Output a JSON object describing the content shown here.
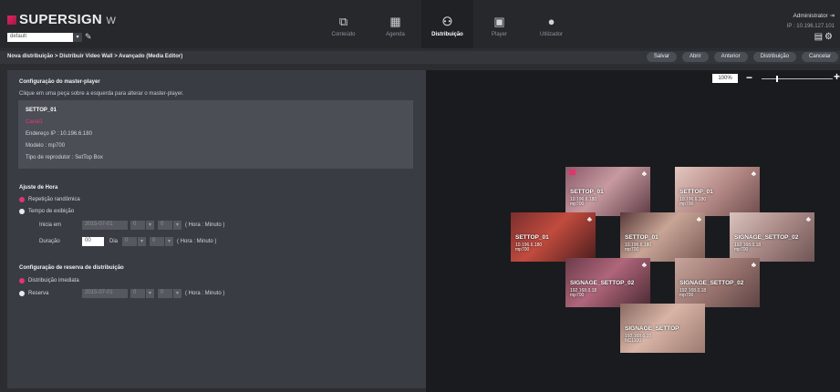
{
  "app": {
    "logo": "SUPERSIGN",
    "logo_suffix": "W",
    "site": "default"
  },
  "nav": [
    {
      "label": "Conteúdo",
      "icon": "content-icon"
    },
    {
      "label": "Agenda",
      "icon": "calendar-icon"
    },
    {
      "label": "Distribuição",
      "icon": "distribution-icon",
      "active": true
    },
    {
      "label": "Player",
      "icon": "player-icon"
    },
    {
      "label": "Utilizador",
      "icon": "user-icon"
    }
  ],
  "user": {
    "name": "Administrator",
    "ip": "IP : 10.196.127.101"
  },
  "breadcrumb": "Nova distribuição > Distribuir Video Wall > Avançado (Media Editor)",
  "actions": [
    "Salvar",
    "Abrir",
    "Anterior",
    "Distribuição",
    "Cancelar"
  ],
  "master": {
    "title": "Configuração do master-player",
    "hint": "Clique em uma peça sobre a esquerda para alterar o master-player.",
    "name": "SETTOP_01",
    "canal": "Canal1",
    "ip": "Endereço IP : 10.196.6.180",
    "model": "Modelo : mp700",
    "type": "Tipo de reprodutor : SetTop Box"
  },
  "time": {
    "title": "Ajuste de Hora",
    "random": "Repetição randômica",
    "duration_mode": "Tempo de exibição",
    "start_label": "Inicia em",
    "start_date": "2015-07-01",
    "start_h": "0",
    "start_m": "0",
    "hm": "( Hora : Minuto )",
    "dur_label": "Duração",
    "dur_days": "00",
    "day": "Dia",
    "dur_h": "0",
    "dur_m": "0"
  },
  "reserve": {
    "title": "Configuração de reserva de distribuição",
    "immediate": "Distribuição imediata",
    "reserve": "Reserva",
    "date": "2015-07-01",
    "h": "0",
    "m": "0",
    "hm": "( Hora : Minuto )"
  },
  "zoom": "100%",
  "tiles": [
    {
      "name": "SETTOP_01",
      "ip": "10.196.6.180",
      "model": "mp700"
    },
    {
      "name": "SETTOP_01",
      "ip": "10.196.6.180",
      "model": "mp700"
    },
    {
      "name": "SETTOP_01",
      "ip": "10.196.6.180",
      "model": "mp700"
    },
    {
      "name": "SETTOP_01",
      "ip": "10.196.6.180",
      "model": "mp700"
    },
    {
      "name": "SIGNAGE_SETTOP_02",
      "ip": "192.168.0.18",
      "model": "mp700"
    },
    {
      "name": "SIGNAGE_SETTOP_02",
      "ip": "192.168.0.18",
      "model": "mp700"
    },
    {
      "name": "SIGNAGE_SETTOP_02",
      "ip": "192.168.0.18",
      "model": "mp700"
    },
    {
      "name": "SIGNAGE_SETTOP",
      "ip": "192.168.0.15",
      "model": "NC1100"
    }
  ]
}
